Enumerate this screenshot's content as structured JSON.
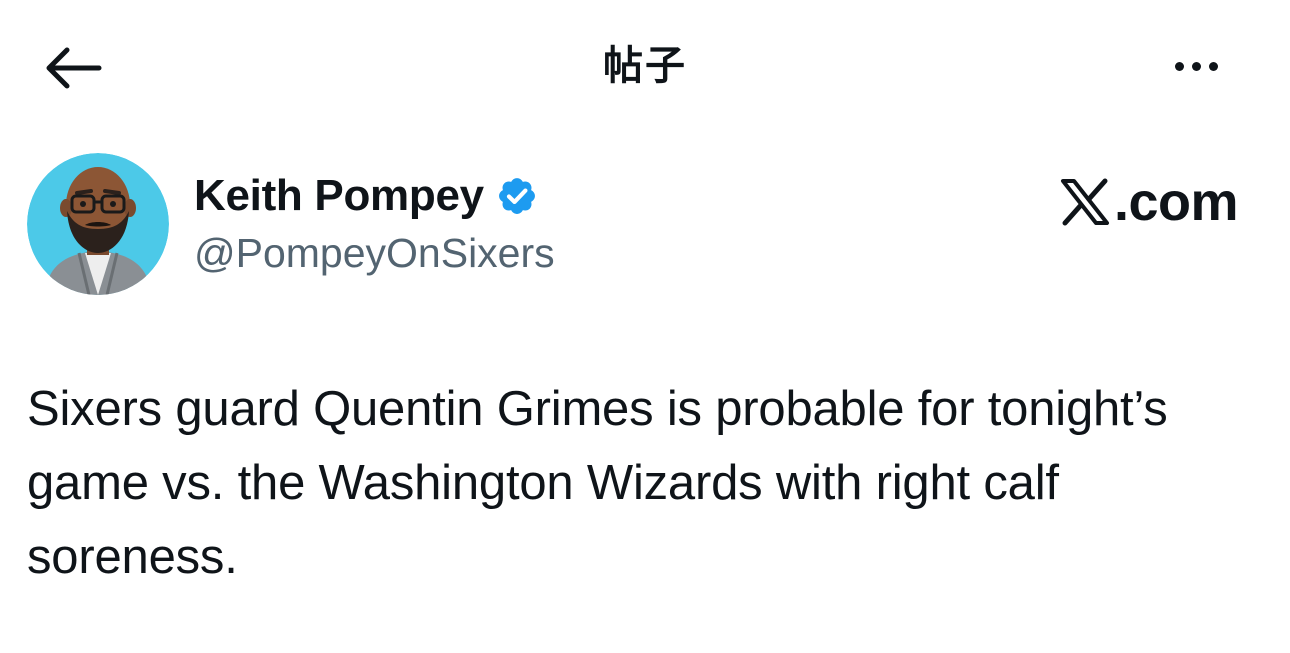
{
  "header": {
    "back_icon": "arrow-left-icon",
    "title": "帖子",
    "more_icon": "more-horizontal-icon"
  },
  "author": {
    "display_name": "Keith Pompey",
    "handle": "@PompeyOnSixers",
    "verified_icon": "verified-badge-icon",
    "verified_color": "#1d9bf0",
    "avatar_background": "#4cc9e8"
  },
  "watermark": {
    "logo_icon": "x-logo-icon",
    "text": ".com"
  },
  "tweet": {
    "text": "Sixers guard Quentin Grimes is probable for tonight’s game vs. the Washington Wizards with right calf soreness."
  },
  "colors": {
    "text_primary": "#0f1419",
    "text_secondary": "#536471"
  }
}
